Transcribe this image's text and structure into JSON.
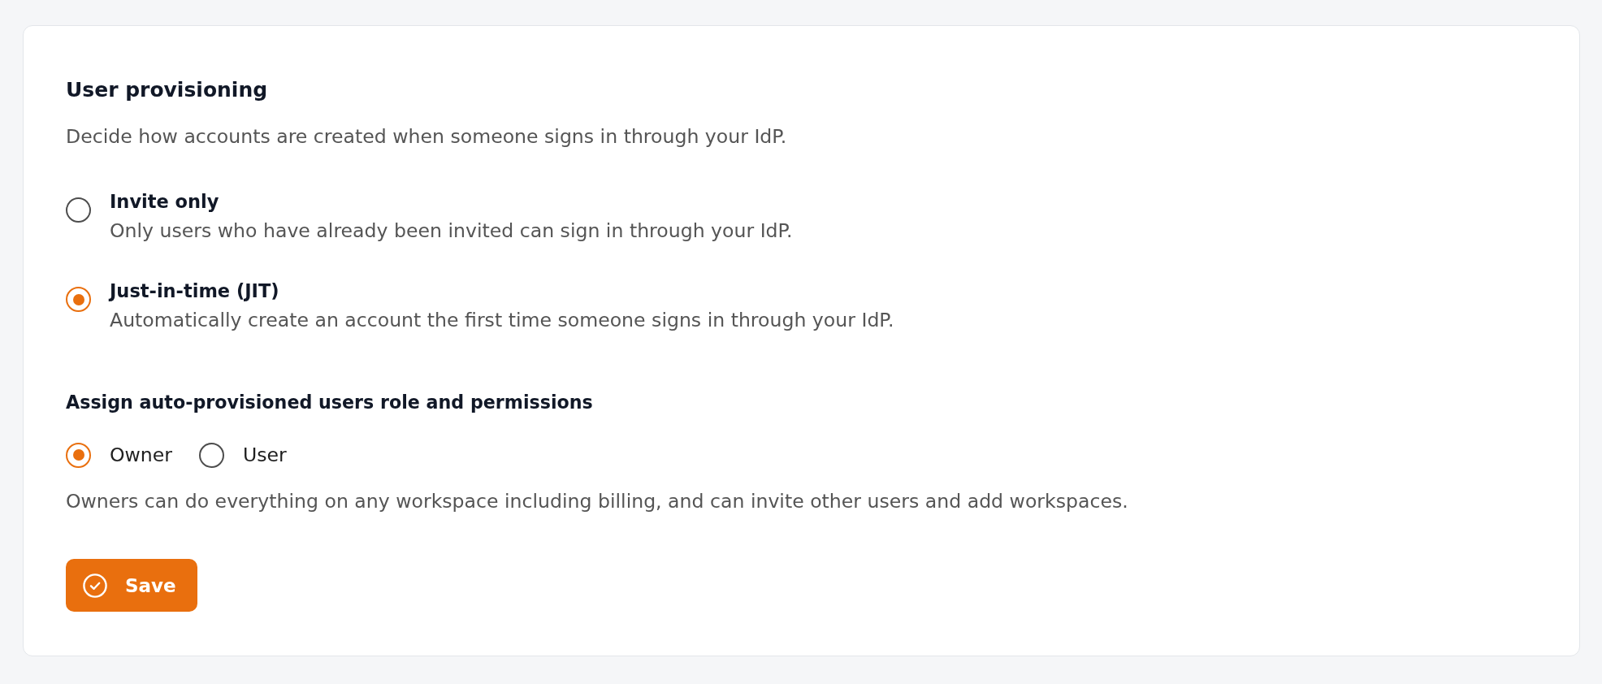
{
  "section": {
    "title": "User provisioning",
    "description": "Decide how accounts are created when someone signs in through your IdP."
  },
  "provisioning_options": [
    {
      "label": "Invite only",
      "description": "Only users who have already been invited can sign in through your IdP.",
      "selected": false
    },
    {
      "label": "Just-in-time (JIT)",
      "description": "Automatically create an account the first time someone signs in through your IdP.",
      "selected": true
    }
  ],
  "role_assignment": {
    "title": "Assign auto-provisioned users role and permissions",
    "roles": [
      {
        "label": "Owner",
        "selected": true
      },
      {
        "label": "User",
        "selected": false
      }
    ],
    "description": "Owners can do everything on any workspace including billing, and can invite other users and add workspaces."
  },
  "save_button": {
    "label": "Save"
  }
}
